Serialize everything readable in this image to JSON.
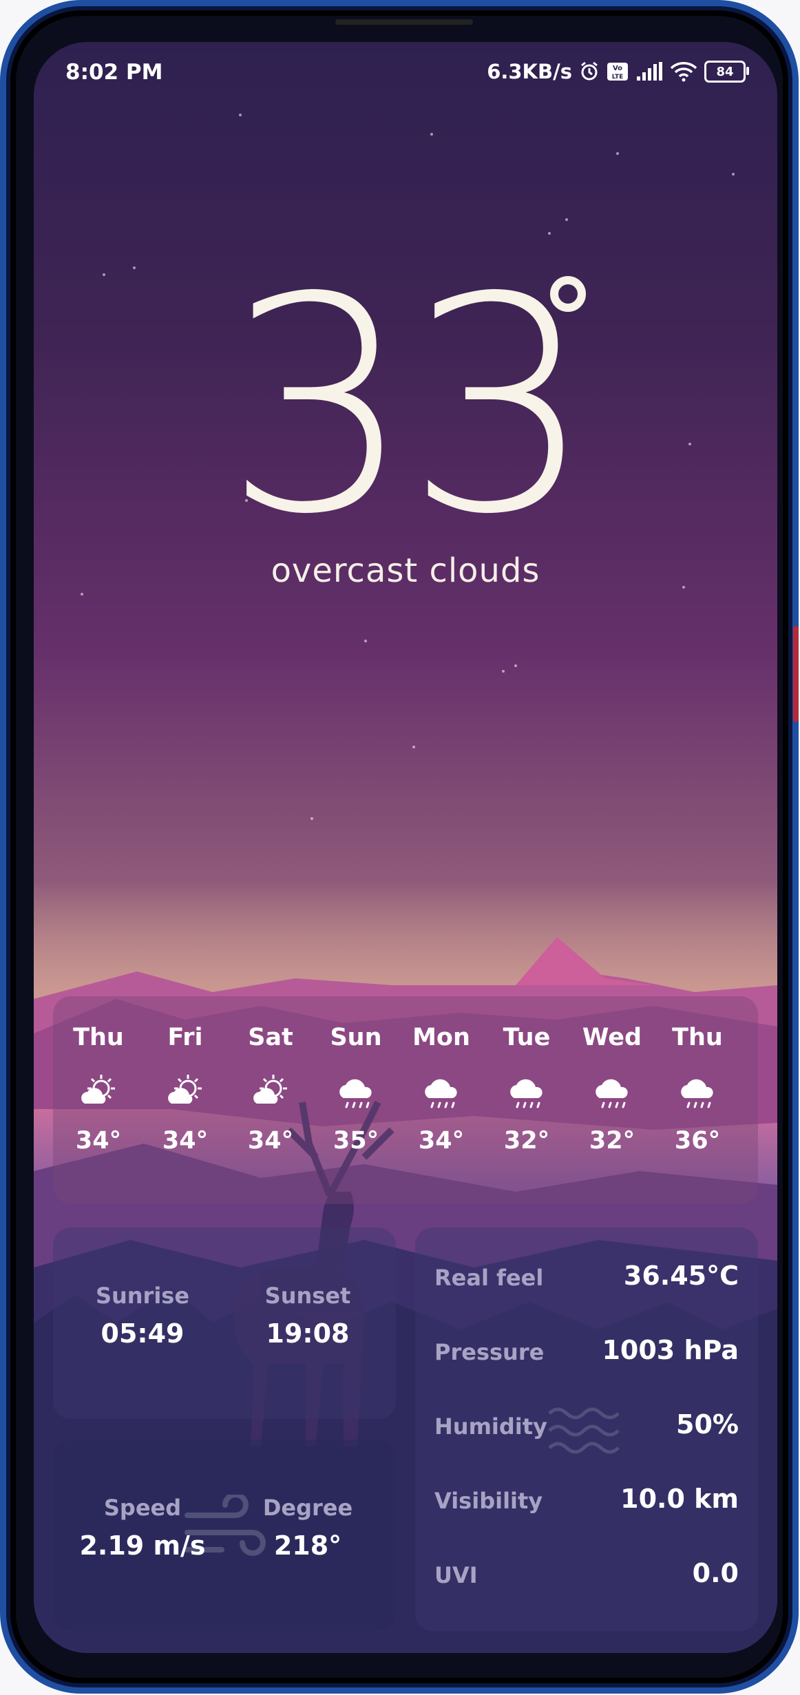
{
  "status_bar": {
    "time": "8:02 PM",
    "network_speed": "6.3KB/s",
    "battery": "84",
    "icons": [
      "alarm-icon",
      "volte-icon",
      "signal-icon",
      "wifi-icon",
      "battery-icon"
    ]
  },
  "current": {
    "temperature": "33",
    "description": "overcast clouds"
  },
  "forecast": [
    {
      "day": "Thu",
      "icon": "partly-sunny-icon",
      "temp": "34°"
    },
    {
      "day": "Fri",
      "icon": "partly-sunny-icon",
      "temp": "34°"
    },
    {
      "day": "Sat",
      "icon": "partly-sunny-icon",
      "temp": "34°"
    },
    {
      "day": "Sun",
      "icon": "rain-cloud-icon",
      "temp": "35°"
    },
    {
      "day": "Mon",
      "icon": "rain-cloud-icon",
      "temp": "34°"
    },
    {
      "day": "Tue",
      "icon": "rain-cloud-icon",
      "temp": "32°"
    },
    {
      "day": "Wed",
      "icon": "rain-cloud-icon",
      "temp": "32°"
    },
    {
      "day": "Thu",
      "icon": "rain-cloud-icon",
      "temp": "36°"
    }
  ],
  "sun": {
    "sunrise_label": "Sunrise",
    "sunrise": "05:49",
    "sunset_label": "Sunset",
    "sunset": "19:08"
  },
  "wind": {
    "speed_label": "Speed",
    "speed": "2.19 m/s",
    "degree_label": "Degree",
    "degree": "218°"
  },
  "details": [
    {
      "label": "Real feel",
      "value": "36.45°C"
    },
    {
      "label": "Pressure",
      "value": "1003 hPa"
    },
    {
      "label": "Humidity",
      "value": "50%"
    },
    {
      "label": "Visibility",
      "value": "10.0 km"
    },
    {
      "label": "UVI",
      "value": "0.0"
    }
  ],
  "colors": {
    "frame": "#1f4fa2",
    "sky_top": "#2e2150",
    "sky_mid": "#66306b",
    "horizon": "#c98f86",
    "text": "#f7f3e8",
    "label": "#a8a3c4"
  }
}
